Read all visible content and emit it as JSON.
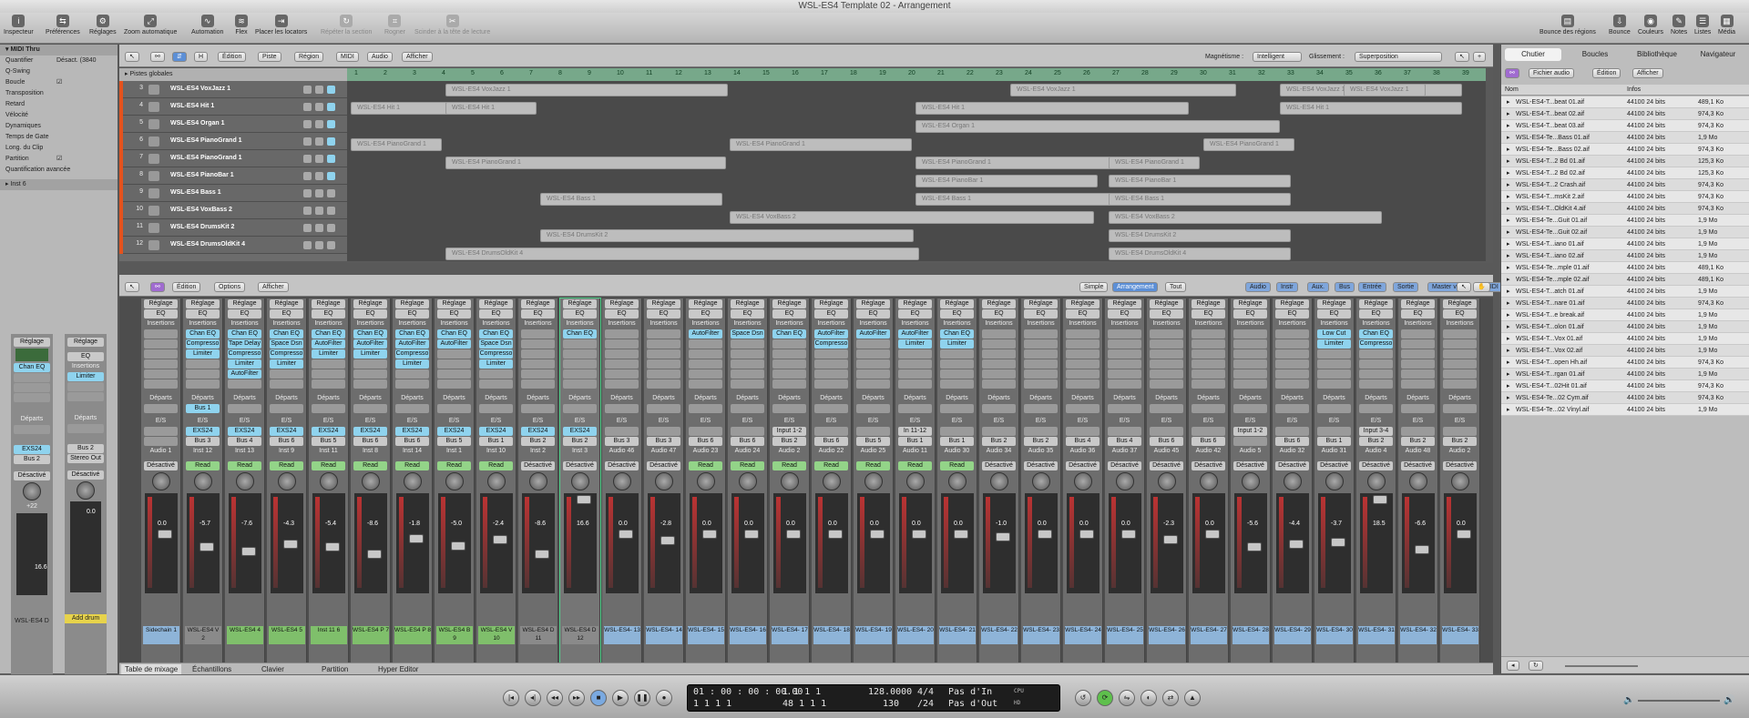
{
  "window": {
    "title": "WSL-ES4 Template 02 - Arrangement"
  },
  "toolbar_left": [
    "Inspecteur",
    "Préférences",
    "Réglages",
    "Zoom automatique",
    "Automation",
    "Flex",
    "Placer les locators",
    "Répéter la section",
    "Rogner",
    "Scinder à la tête de lecture"
  ],
  "toolbar_right": [
    "Bounce des régions",
    "Bounce",
    "Couleurs",
    "Notes",
    "Listes",
    "Média"
  ],
  "inspector": {
    "header": "MIDI Thru",
    "rows": [
      {
        "label": "Quantifier",
        "value": "Désact. (3840"
      },
      {
        "label": "Q-Swing",
        "value": ""
      },
      {
        "label": "Boucle",
        "value": "☑"
      },
      {
        "label": "Transposition",
        "value": ""
      },
      {
        "label": "Retard",
        "value": ""
      },
      {
        "label": "Vélocité",
        "value": ""
      },
      {
        "label": "Dynamiques",
        "value": ""
      },
      {
        "label": "Temps de Gate",
        "value": ""
      },
      {
        "label": "Long. du Clip",
        "value": ""
      },
      {
        "label": "Partition",
        "value": "☑"
      },
      {
        "label": "Quantification avancée",
        "value": ""
      }
    ],
    "group": "Inst 6",
    "strip1": {
      "reglage": "Réglage",
      "insert": "Chan EQ",
      "departs": "Départs",
      "io": "EXS24",
      "bus": "Bus 2",
      "auto": "Désactivé",
      "pan": "+22",
      "level": "16.6",
      "name": "WSL-ES4 D"
    },
    "strip2": {
      "reglage": "Réglage",
      "eq": "EQ",
      "insertions": "Insertions",
      "insert": "Limiter",
      "departs": "Départs",
      "io": "Bus 2",
      "out": "Stereo Out",
      "auto": "Désactivé",
      "level": "0.0",
      "name": "Add drum"
    }
  },
  "arrange": {
    "menus": [
      "Édition",
      "Piste",
      "Région",
      "MIDI",
      "Audio",
      "Afficher"
    ],
    "magnetisme_label": "Magnétisme :",
    "magnetisme": "Intelligent",
    "glissement_label": "Glissement :",
    "glissement": "Superposition",
    "global_tracks": "Pistes globales",
    "ruler": [
      "1",
      "2",
      "3",
      "4",
      "5",
      "6",
      "7",
      "8",
      "9",
      "10",
      "11",
      "12",
      "13",
      "14",
      "15",
      "16",
      "17",
      "18",
      "19",
      "20",
      "21",
      "22",
      "23",
      "24",
      "25",
      "26",
      "27",
      "28",
      "29",
      "30",
      "31",
      "32",
      "33",
      "34",
      "35",
      "36",
      "37",
      "38",
      "39"
    ],
    "tracks": [
      {
        "num": "3",
        "name": "WSL-ES4 VoxJazz 1"
      },
      {
        "num": "4",
        "name": "WSL-ES4 Hit 1"
      },
      {
        "num": "5",
        "name": "WSL-ES4 Organ 1"
      },
      {
        "num": "6",
        "name": "WSL-ES4 PianoGrand 1"
      },
      {
        "num": "7",
        "name": "WSL-ES4 PianoGrand 1"
      },
      {
        "num": "8",
        "name": "WSL-ES4 PianoBar 1"
      },
      {
        "num": "9",
        "name": "WSL-ES4 Bass 1"
      },
      {
        "num": "10",
        "name": "WSL-ES4 VoxBass 2"
      },
      {
        "num": "11",
        "name": "WSL-ES4 DrumsKit 2"
      },
      {
        "num": "12",
        "name": "WSL-ES4 DrumsOldKit 4"
      }
    ]
  },
  "mixer": {
    "menus": [
      "Édition",
      "Options",
      "Afficher"
    ],
    "views": [
      "Simple",
      "Arrangement",
      "Tout"
    ],
    "filters": [
      "Audio",
      "Instr",
      "Aux.",
      "Bus",
      "Entrée",
      "Sortie",
      "Master vol.",
      "MIDI"
    ],
    "section_labels": {
      "reglage": "Réglage",
      "eq": "EQ",
      "insertions": "Insertions",
      "departs": "Départs",
      "es": "E/S"
    },
    "channels": [
      {
        "ins": [],
        "send": "",
        "in": "",
        "out": "",
        "track": "Audio 1",
        "auto": "Désactivé",
        "pan": "",
        "lvl": "0.0",
        "name": "Sidechain 1",
        "c": "b"
      },
      {
        "ins": [
          "Chan EQ",
          "Compresso",
          "Limiter"
        ],
        "send": "Bus 1",
        "in": "EXS24",
        "out": "Bus 3",
        "track": "Inst 12",
        "auto": "Read",
        "pan": "",
        "lvl": "-5.7",
        "name": "WSL-ES4 V 2",
        "c": ""
      },
      {
        "ins": [
          "Chan EQ",
          "Tape Delay",
          "Compresso",
          "Limiter",
          "AutoFilter"
        ],
        "send": "",
        "in": "EXS24",
        "out": "Bus 4",
        "track": "Inst 13",
        "auto": "Read",
        "pan": "+10",
        "lvl": "-7.6",
        "name": "WSL-ES4 4",
        "c": "g"
      },
      {
        "ins": [
          "Chan EQ",
          "Space Dsn",
          "Compresso",
          "Limiter"
        ],
        "send": "",
        "in": "EXS24",
        "out": "Bus 6",
        "track": "Inst 9",
        "auto": "Read",
        "pan": "",
        "lvl": "-4.3",
        "name": "WSL-ES4 5",
        "c": "g"
      },
      {
        "ins": [
          "Chan EQ",
          "AutoFilter",
          "Limiter"
        ],
        "send": "",
        "in": "EXS24",
        "out": "Bus 5",
        "track": "Inst 11",
        "auto": "Read",
        "pan": "-7",
        "lvl": "-5.4",
        "name": "Inst 11 6",
        "c": "g"
      },
      {
        "ins": [
          "Chan EQ",
          "AutoFilter",
          "Limiter"
        ],
        "send": "",
        "in": "EXS24",
        "out": "Bus 6",
        "track": "Inst 8",
        "auto": "Read",
        "pan": "-13",
        "lvl": "-8.6",
        "name": "WSL-ES4 P 7",
        "c": "g"
      },
      {
        "ins": [
          "Chan EQ",
          "AutoFilter",
          "Compresso",
          "Limiter"
        ],
        "send": "",
        "in": "EXS24",
        "out": "Bus 6",
        "track": "Inst 14",
        "auto": "Read",
        "pan": "-17",
        "lvl": "-1.8",
        "name": "WSL-ES4 P 8",
        "c": "g"
      },
      {
        "ins": [
          "Chan EQ",
          "AutoFilter"
        ],
        "send": "",
        "in": "EXS24",
        "out": "Bus 5",
        "track": "Inst 1",
        "auto": "Read",
        "pan": "",
        "lvl": "-5.0",
        "name": "WSL-ES4 B 9",
        "c": "g"
      },
      {
        "ins": [
          "Chan EQ",
          "Space Dsn",
          "Compresso",
          "Limiter"
        ],
        "send": "",
        "in": "EXS24",
        "out": "Bus 1",
        "track": "Inst 10",
        "auto": "Read",
        "pan": "",
        "lvl": "-2.4",
        "name": "WSL-ES4 V 10",
        "c": "g"
      },
      {
        "ins": [],
        "send": "",
        "in": "EXS24",
        "out": "Bus 2",
        "track": "Inst 2",
        "auto": "Désactivé",
        "pan": "",
        "lvl": "-8.6",
        "name": "WSL-ES4 D 11",
        "c": ""
      },
      {
        "ins": [
          "Chan EQ"
        ],
        "send": "",
        "in": "EXS24",
        "out": "Bus 2",
        "track": "Inst 3",
        "auto": "Désactivé",
        "pan": "+22",
        "lvl": "16.6",
        "name": "WSL-ES4 D 12",
        "c": ""
      },
      {
        "ins": [],
        "send": "",
        "in": "",
        "out": "Bus 3",
        "track": "Audio 46",
        "auto": "Désactivé",
        "pan": "",
        "lvl": "0.0",
        "name": "WSL-ES4- 13",
        "c": "b"
      },
      {
        "ins": [],
        "send": "",
        "in": "",
        "out": "Bus 3",
        "track": "Audio 47",
        "auto": "Désactivé",
        "pan": "",
        "lvl": "-2.8",
        "name": "WSL-ES4- 14",
        "c": "b"
      },
      {
        "ins": [
          "AutoFilter"
        ],
        "send": "",
        "in": "",
        "out": "Bus 6",
        "track": "Audio 23",
        "auto": "Read",
        "pan": "",
        "lvl": "0.0",
        "name": "WSL-ES4- 15",
        "c": "b"
      },
      {
        "ins": [
          "Space Dsn"
        ],
        "send": "",
        "in": "",
        "out": "Bus 6",
        "track": "Audio 24",
        "auto": "Read",
        "pan": "",
        "lvl": "0.0",
        "name": "WSL-ES4- 16",
        "c": "b"
      },
      {
        "ins": [
          "Chan EQ"
        ],
        "send": "",
        "in": "Input 1-2",
        "out": "Bus 2",
        "track": "Audio 2",
        "auto": "Read",
        "pan": "",
        "lvl": "0.0",
        "name": "WSL-ES4- 17",
        "c": "b"
      },
      {
        "ins": [
          "AutoFilter",
          "Compresso"
        ],
        "send": "",
        "in": "",
        "out": "Bus 6",
        "track": "Audio 22",
        "auto": "Read",
        "pan": "",
        "lvl": "0.0",
        "name": "WSL-ES4- 18",
        "c": "b"
      },
      {
        "ins": [
          "AutoFilter"
        ],
        "send": "",
        "in": "",
        "out": "Bus 5",
        "track": "Audio 25",
        "auto": "Read",
        "pan": "",
        "lvl": "0.0",
        "name": "WSL-ES4- 19",
        "c": "b"
      },
      {
        "ins": [
          "AutoFilter",
          "Limiter"
        ],
        "send": "",
        "in": "In 11-12",
        "out": "Bus 1",
        "track": "Audio 11",
        "auto": "Read",
        "pan": "",
        "lvl": "0.0",
        "name": "WSL-ES4- 20",
        "c": "b"
      },
      {
        "ins": [
          "Chan EQ",
          "Limiter"
        ],
        "send": "",
        "in": "",
        "out": "Bus 1",
        "track": "Audio 30",
        "auto": "Read",
        "pan": "",
        "lvl": "0.0",
        "name": "WSL-ES4- 21",
        "c": "b"
      },
      {
        "ins": [],
        "send": "",
        "in": "",
        "out": "Bus 2",
        "track": "Audio 34",
        "auto": "Désactivé",
        "pan": "",
        "lvl": "-1.0",
        "name": "WSL-ES4- 22",
        "c": "b"
      },
      {
        "ins": [],
        "send": "",
        "in": "",
        "out": "Bus 2",
        "track": "Audio 35",
        "auto": "Désactivé",
        "pan": "",
        "lvl": "0.0",
        "name": "WSL-ES4- 23",
        "c": "b"
      },
      {
        "ins": [],
        "send": "",
        "in": "",
        "out": "Bus 4",
        "track": "Audio 36",
        "auto": "Désactivé",
        "pan": "",
        "lvl": "0.0",
        "name": "WSL-ES4- 24",
        "c": "b"
      },
      {
        "ins": [],
        "send": "",
        "in": "",
        "out": "Bus 4",
        "track": "Audio 37",
        "auto": "Désactivé",
        "pan": "",
        "lvl": "0.0",
        "name": "WSL-ES4- 25",
        "c": "b"
      },
      {
        "ins": [],
        "send": "",
        "in": "",
        "out": "Bus 6",
        "track": "Audio 45",
        "auto": "Désactivé",
        "pan": "-15",
        "lvl": "-2.3",
        "name": "WSL-ES4- 26",
        "c": "b"
      },
      {
        "ins": [],
        "send": "",
        "in": "",
        "out": "Bus 6",
        "track": "Audio 42",
        "auto": "Désactivé",
        "pan": "",
        "lvl": "0.0",
        "name": "WSL-ES4- 27",
        "c": "b"
      },
      {
        "ins": [],
        "send": "",
        "in": "Input 1-2",
        "out": "",
        "track": "Audio 5",
        "auto": "Désactivé",
        "pan": "",
        "lvl": "-5.6",
        "name": "WSL-ES4- 28",
        "c": "b"
      },
      {
        "ins": [],
        "send": "",
        "in": "",
        "out": "Bus 6",
        "track": "Audio 32",
        "auto": "Désactivé",
        "pan": "",
        "lvl": "-4.4",
        "name": "WSL-ES4- 29",
        "c": "b"
      },
      {
        "ins": [
          "Low Cut",
          "Limiter"
        ],
        "send": "",
        "in": "",
        "out": "Bus 1",
        "track": "Audio 31",
        "auto": "Désactivé",
        "pan": "",
        "lvl": "-3.7",
        "name": "WSL-ES4- 30",
        "c": "b"
      },
      {
        "ins": [
          "Chan EQ",
          "Compresso"
        ],
        "send": "",
        "in": "Input 3-4",
        "out": "Bus 2",
        "track": "Audio 4",
        "auto": "Désactivé",
        "pan": "+18",
        "lvl": "18.5",
        "name": "WSL-ES4- 31",
        "c": "b"
      },
      {
        "ins": [],
        "send": "",
        "in": "",
        "out": "Bus 2",
        "track": "Audio 48",
        "auto": "Désactivé",
        "pan": "+18",
        "lvl": "-6.6",
        "name": "WSL-ES4- 32",
        "c": "b"
      },
      {
        "ins": [],
        "send": "",
        "in": "",
        "out": "Bus 2",
        "track": "Audio 2",
        "auto": "Désactivé",
        "pan": "",
        "lvl": "0.0",
        "name": "WSL-ES4- 33",
        "c": "b"
      }
    ]
  },
  "bottom_tabs": [
    "Table de mixage",
    "Échantillons",
    "Clavier",
    "Partition",
    "Hyper Editor"
  ],
  "library": {
    "tabs": [
      "Chutier",
      "Boucles",
      "Bibliothèque",
      "Navigateur"
    ],
    "menus": [
      "Fichier audio",
      "Édition",
      "Afficher"
    ],
    "col_name": "Nom",
    "col_info": "Infos",
    "files": [
      {
        "n": "WSL-ES4-T...beat 01.aif",
        "s": "489,1 Ko"
      },
      {
        "n": "WSL-ES4-T...beat 02.aif",
        "s": "974,3 Ko"
      },
      {
        "n": "WSL-ES4-T...beat 03.aif",
        "s": "974,3 Ko"
      },
      {
        "n": "WSL-ES4-Te...Bass 01.aif",
        "s": "1,9 Mo"
      },
      {
        "n": "WSL-ES4-Te...Bass 02.aif",
        "s": "974,3 Ko"
      },
      {
        "n": "WSL-ES4-T...2 Bd 01.aif",
        "s": "125,3 Ko"
      },
      {
        "n": "WSL-ES4-T...2 Bd 02.aif",
        "s": "125,3 Ko"
      },
      {
        "n": "WSL-ES4-T...2 Crash.aif",
        "s": "974,3 Ko"
      },
      {
        "n": "WSL-ES4-T...msKit 2.aif",
        "s": "974,3 Ko"
      },
      {
        "n": "WSL-ES4-T...OldKit 4.aif",
        "s": "974,3 Ko"
      },
      {
        "n": "WSL-ES4-Te...Guit 01.aif",
        "s": "1,9 Mo"
      },
      {
        "n": "WSL-ES4-Te...Guit 02.aif",
        "s": "1,9 Mo"
      },
      {
        "n": "WSL-ES4-T...iano 01.aif",
        "s": "1,9 Mo"
      },
      {
        "n": "WSL-ES4-T...iano 02.aif",
        "s": "1,9 Mo"
      },
      {
        "n": "WSL-ES4-Te...mple 01.aif",
        "s": "489,1 Ko"
      },
      {
        "n": "WSL-ES4-Te...mple 02.aif",
        "s": "489,1 Ko"
      },
      {
        "n": "WSL-ES4-T...atch 01.aif",
        "s": "1,9 Mo"
      },
      {
        "n": "WSL-ES4-T...nare 01.aif",
        "s": "974,3 Ko"
      },
      {
        "n": "WSL-ES4-T...e break.aif",
        "s": "1,9 Mo"
      },
      {
        "n": "WSL-ES4-T...olon 01.aif",
        "s": "1,9 Mo"
      },
      {
        "n": "WSL-ES4-T...Vox 01.aif",
        "s": "1,9 Mo"
      },
      {
        "n": "WSL-ES4-T...Vox 02.aif",
        "s": "1,9 Mo"
      },
      {
        "n": "WSL-ES4-T...open Hh.aif",
        "s": "974,3 Ko"
      },
      {
        "n": "WSL-ES4-T...rgan 01.aif",
        "s": "1,9 Mo"
      },
      {
        "n": "WSL-ES4-T...02Hit 01.aif",
        "s": "974,3 Ko"
      },
      {
        "n": "WSL-ES4-Te...02 Cym.aif",
        "s": "974,3 Ko"
      },
      {
        "n": "WSL-ES4-Te...02 Vinyl.aif",
        "s": "1,9 Mo"
      }
    ],
    "fileinfo": "44100  24 bits"
  },
  "transport": {
    "smpte": "01 : 00 : 00 : 00.00",
    "bars1": "1    1    1      1",
    "bars2": "1    1    1      1",
    "bars3": "1    1    1      1",
    "bars4": "48    1    1      1",
    "tempo": "128.0000",
    "tempo2": "130",
    "sig": "4/4",
    "div": "/24",
    "in": "Pas d'In",
    "out": "Pas d'Out",
    "cpu": "CPU",
    "hd": "HD"
  }
}
